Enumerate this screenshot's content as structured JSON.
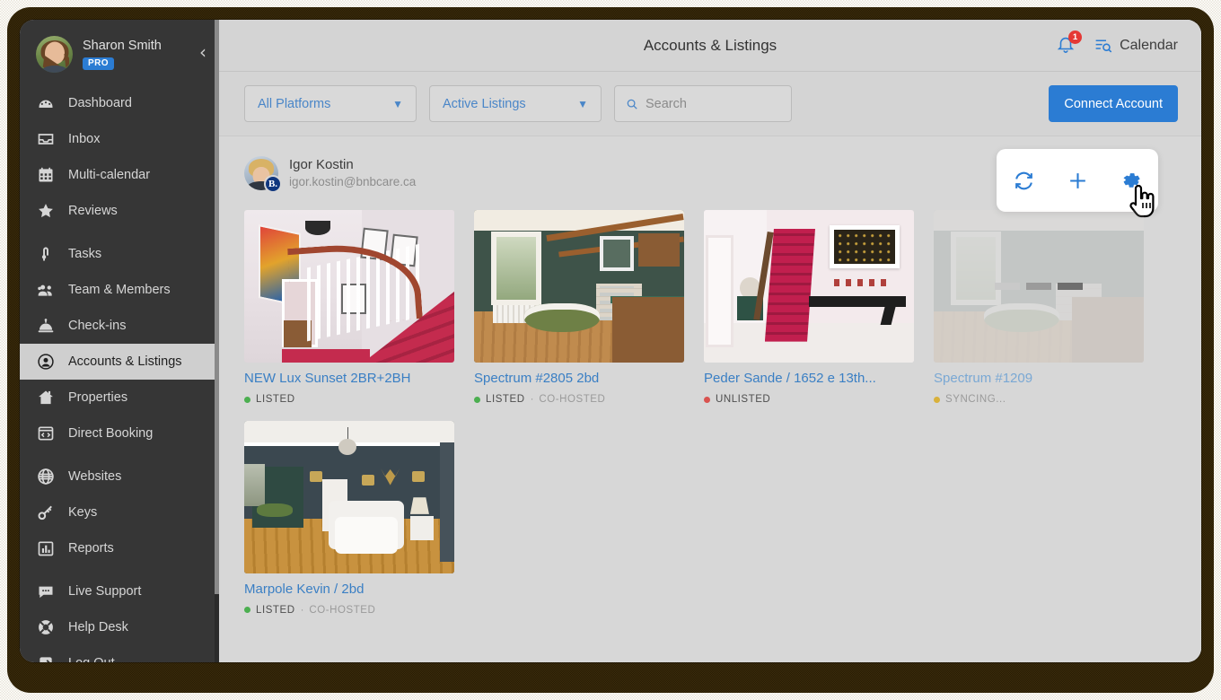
{
  "sidebar": {
    "profile": {
      "name": "Sharon Smith",
      "badge": "PRO",
      "avatar_icon": "user-avatar",
      "collapse_icon": "chevron-left-icon"
    },
    "items": [
      {
        "label": "Dashboard",
        "icon": "dashboard-icon",
        "active": false
      },
      {
        "label": "Inbox",
        "icon": "inbox-icon",
        "active": false
      },
      {
        "label": "Multi-calendar",
        "icon": "calendar-icon",
        "active": false
      },
      {
        "label": "Reviews",
        "icon": "star-icon",
        "active": false
      },
      {
        "label": "Tasks",
        "icon": "tasks-icon",
        "active": false
      },
      {
        "label": "Team & Members",
        "icon": "users-icon",
        "active": false
      },
      {
        "label": "Check-ins",
        "icon": "bell-desk-icon",
        "active": false
      },
      {
        "label": "Accounts & Listings",
        "icon": "account-icon",
        "active": true
      },
      {
        "label": "Properties",
        "icon": "home-icon",
        "active": false
      },
      {
        "label": "Direct Booking",
        "icon": "code-window-icon",
        "active": false
      },
      {
        "label": "Websites",
        "icon": "globe-icon",
        "active": false
      },
      {
        "label": "Keys",
        "icon": "key-icon",
        "active": false
      },
      {
        "label": "Reports",
        "icon": "bar-chart-icon",
        "active": false
      },
      {
        "label": "Live Support",
        "icon": "chat-icon",
        "active": false
      },
      {
        "label": "Help Desk",
        "icon": "lifebuoy-icon",
        "active": false
      },
      {
        "label": "Log Out",
        "icon": "logout-icon",
        "active": false
      }
    ]
  },
  "header": {
    "title": "Accounts & Listings",
    "notifications": {
      "icon": "bell-icon",
      "count": "1"
    },
    "calendar": {
      "icon": "calendar-search-icon",
      "label": "Calendar"
    }
  },
  "filters": {
    "platform": {
      "value": "All Platforms",
      "chevron": "chevron-down-icon"
    },
    "status": {
      "value": "Active Listings",
      "chevron": "chevron-down-icon"
    },
    "search": {
      "icon": "search-icon",
      "value": "",
      "placeholder": "Search"
    },
    "connect_button": "Connect Account"
  },
  "account": {
    "name": "Igor Kostin",
    "email": "igor.kostin@bnbcare.ca",
    "avatar_icon": "account-avatar",
    "platform_badge": "B.",
    "actions": [
      {
        "icon": "refresh-icon",
        "name": "sync-button"
      },
      {
        "icon": "plus-icon",
        "name": "add-listing-button"
      },
      {
        "icon": "gear-icon",
        "name": "settings-button"
      }
    ],
    "cursor_icon": "hand-pointer-cursor"
  },
  "listings": [
    {
      "title": "NEW Lux Sunset 2BR+2BH",
      "status": "LISTED",
      "status_color": "#4caf50",
      "sub_status": "",
      "state": "normal",
      "thumb": "staircase-white-red"
    },
    {
      "title": "Spectrum #2805 2bd",
      "status": "LISTED",
      "status_color": "#4caf50",
      "sub_status": "CO-HOSTED",
      "state": "normal",
      "thumb": "green-bathroom"
    },
    {
      "title": "Peder Sande / 1652 e 13th...",
      "status": "UNLISTED",
      "status_color": "#d9534f",
      "sub_status": "",
      "state": "normal",
      "thumb": "pink-hallway"
    },
    {
      "title": "Spectrum #1209",
      "status": "SYNCING...",
      "status_color": "#d9b13b",
      "sub_status": "",
      "state": "syncing",
      "thumb": "bathroom-faded"
    },
    {
      "title": "Marpole Kevin / 2bd",
      "status": "LISTED",
      "status_color": "#4caf50",
      "sub_status": "CO-HOSTED",
      "state": "normal",
      "thumb": "teal-bedroom"
    }
  ],
  "colors": {
    "accent_blue": "#2b7cd3",
    "link_blue": "#3a7fc4",
    "sidebar_bg": "#363636",
    "content_bg": "#d7d7d7",
    "badge_red": "#e53935",
    "status_green": "#4caf50",
    "status_red": "#d9534f",
    "status_yellow": "#d9b13b"
  }
}
